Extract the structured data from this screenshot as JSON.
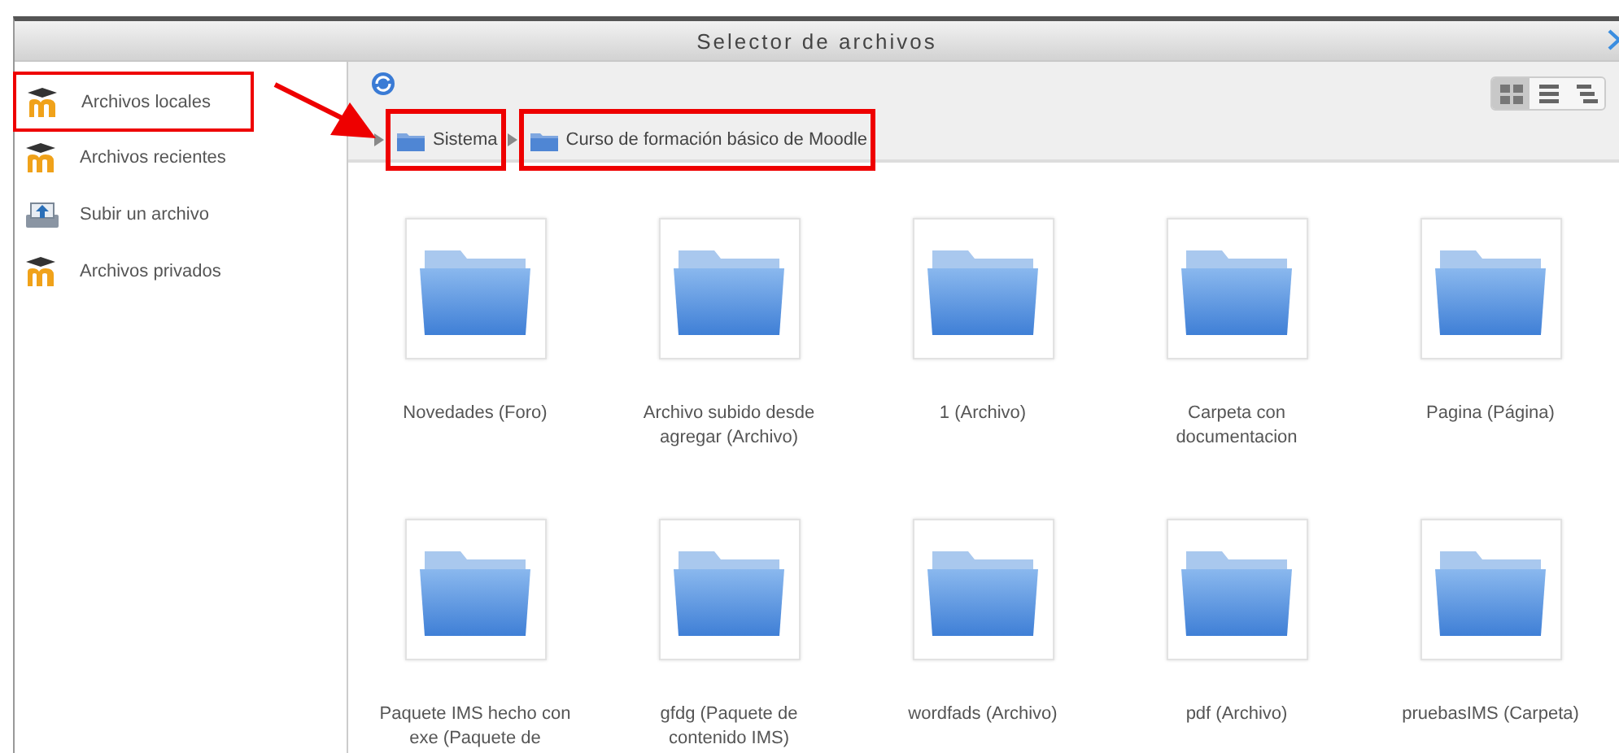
{
  "window": {
    "title": "Selector de archivos"
  },
  "sidebar": {
    "items": [
      {
        "kind": "moodle",
        "label": "Archivos locales",
        "highlighted": true
      },
      {
        "kind": "moodle",
        "label": "Archivos recientes",
        "highlighted": false
      },
      {
        "kind": "upload",
        "label": "Subir un archivo",
        "highlighted": false
      },
      {
        "kind": "moodle",
        "label": "Archivos privados",
        "highlighted": false
      }
    ]
  },
  "annotation_arrow": true,
  "view_modes": [
    {
      "kind": "icons",
      "selected": true
    },
    {
      "kind": "list",
      "selected": false
    },
    {
      "kind": "tree",
      "selected": false
    }
  ],
  "breadcrumb": [
    {
      "label": "Sistema",
      "highlighted": true
    },
    {
      "label": "Curso de formación básico de Moodle",
      "highlighted": true
    }
  ],
  "files": [
    {
      "label": "Novedades (Foro)"
    },
    {
      "label": "Archivo subido desde agregar (Archivo)"
    },
    {
      "label": "1 (Archivo)"
    },
    {
      "label": "Carpeta con documentacion"
    },
    {
      "label": "Pagina (Página)"
    },
    {
      "label": "Paquete IMS hecho con exe (Paquete de"
    },
    {
      "label": "gfdg (Paquete de contenido IMS)"
    },
    {
      "label": "wordfads (Archivo)"
    },
    {
      "label": "pdf (Archivo)"
    },
    {
      "label": "pruebasIMS (Carpeta)"
    }
  ]
}
